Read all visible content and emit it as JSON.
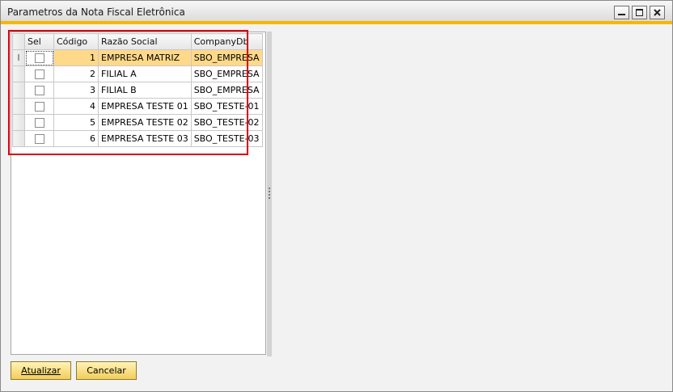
{
  "window": {
    "title": "Parametros da Nota Fiscal Eletrônica",
    "accent_color": "#f5b800",
    "controls": {
      "minimize_icon": "minimize-icon",
      "maximize_icon": "maximize-icon",
      "close_icon": "close-icon"
    }
  },
  "grid": {
    "columns": {
      "sel": "Sel",
      "codigo": "Código",
      "razao": "Razão Social",
      "company": "CompanyDb"
    },
    "row_cursor": "I",
    "rows": [
      {
        "codigo": "1",
        "razao": "EMPRESA MATRIZ",
        "company": "SBO_EMPRESA",
        "checked": false,
        "selected": true
      },
      {
        "codigo": "2",
        "razao": "FILIAL A",
        "company": "SBO_EMPRESA",
        "checked": false,
        "selected": false
      },
      {
        "codigo": "3",
        "razao": "FILIAL B",
        "company": "SBO_EMPRESA",
        "checked": false,
        "selected": false
      },
      {
        "codigo": "4",
        "razao": "EMPRESA TESTE 01",
        "company": "SBO_TESTE-01",
        "checked": false,
        "selected": false
      },
      {
        "codigo": "5",
        "razao": "EMPRESA TESTE 02",
        "company": "SBO_TESTE-02",
        "checked": false,
        "selected": false
      },
      {
        "codigo": "6",
        "razao": "EMPRESA TESTE 03",
        "company": "SBO_TESTE-03",
        "checked": false,
        "selected": false
      }
    ],
    "selected_row_color": "#ffd98a",
    "highlight_color": "#d9000d"
  },
  "buttons": {
    "update": {
      "label": "Atualizar",
      "accel": "A",
      "rest": "tualizar"
    },
    "cancel": {
      "label": "Cancelar"
    }
  }
}
